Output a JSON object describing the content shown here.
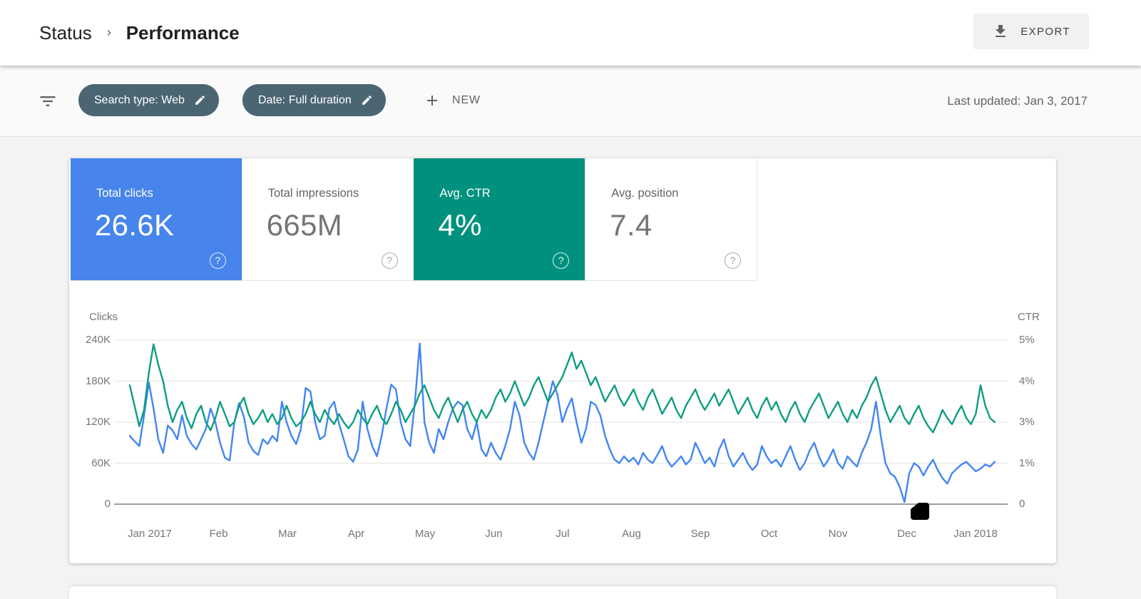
{
  "header": {
    "breadcrumb": {
      "root": "Status",
      "current": "Performance"
    },
    "export_label": "EXPORT"
  },
  "filter_bar": {
    "chips": [
      {
        "label": "Search type: Web"
      },
      {
        "label": "Date: Full duration"
      }
    ],
    "new_label": "NEW",
    "last_updated": "Last updated: Jan 3, 2017"
  },
  "metrics": [
    {
      "label": "Total clicks",
      "value": "26.6K",
      "selected": true,
      "color": "#4784ec"
    },
    {
      "label": "Total impressions",
      "value": "665M",
      "selected": false,
      "color": ""
    },
    {
      "label": "Avg. CTR",
      "value": "4%",
      "selected": true,
      "color": "#00917e"
    },
    {
      "label": "Avg. position",
      "value": "7.4",
      "selected": false,
      "color": ""
    }
  ],
  "chart_data": {
    "type": "line",
    "title": "Clicks and CTR over time, daily, Jan 2017 - Jan 2018",
    "grid": true,
    "legend_position": "none",
    "x_labels": [
      "Jan 2017",
      "Feb",
      "Mar",
      "Apr",
      "May",
      "Jun",
      "Jul",
      "Aug",
      "Sep",
      "Oct",
      "Nov",
      "Dec",
      "Jan 2018"
    ],
    "left_axis": {
      "label": "Clicks",
      "tick_labels": [
        "0",
        "60K",
        "120K",
        "180K",
        "240K"
      ],
      "tick_values": [
        0,
        60,
        120,
        180,
        240
      ],
      "unit": "thousands",
      "ylim": [
        0,
        240
      ]
    },
    "right_axis": {
      "label": "CTR",
      "tick_labels": [
        "0",
        "1%",
        "3%",
        "4%",
        "5%"
      ],
      "tick_values": [
        0,
        1,
        3,
        4,
        5
      ],
      "unit": "percent",
      "ylim": [
        0,
        5
      ]
    },
    "series": [
      {
        "name": "Clicks",
        "axis": "left",
        "color": "#4285f4",
        "unit": "K",
        "values": [
          100,
          92,
          85,
          130,
          178,
          140,
          95,
          75,
          115,
          108,
          95,
          130,
          100,
          88,
          80,
          95,
          110,
          140,
          120,
          90,
          68,
          64,
          120,
          148,
          128,
          90,
          78,
          72,
          95,
          88,
          100,
          92,
          150,
          120,
          100,
          88,
          110,
          170,
          165,
          120,
          95,
          100,
          140,
          150,
          118,
          95,
          70,
          62,
          80,
          150,
          110,
          85,
          70,
          100,
          140,
          175,
          168,
          120,
          95,
          85,
          150,
          235,
          120,
          90,
          75,
          110,
          95,
          120,
          140,
          150,
          145,
          110,
          95,
          120,
          80,
          70,
          90,
          75,
          65,
          85,
          110,
          150,
          130,
          90,
          75,
          65,
          90,
          120,
          150,
          180,
          160,
          120,
          140,
          155,
          120,
          90,
          110,
          150,
          145,
          130,
          100,
          80,
          65,
          60,
          70,
          62,
          68,
          58,
          75,
          65,
          60,
          72,
          85,
          65,
          55,
          62,
          70,
          58,
          65,
          90,
          75,
          60,
          68,
          55,
          80,
          95,
          70,
          55,
          65,
          75,
          60,
          50,
          58,
          85,
          70,
          60,
          65,
          55,
          70,
          85,
          65,
          50,
          60,
          78,
          90,
          70,
          55,
          65,
          80,
          60,
          52,
          70,
          62,
          55,
          75,
          90,
          110,
          150,
          100,
          60,
          45,
          40,
          25,
          3,
          45,
          60,
          55,
          42,
          55,
          65,
          50,
          38,
          30,
          45,
          52,
          58,
          62,
          55,
          48,
          52,
          58,
          55,
          62
        ]
      },
      {
        "name": "CTR",
        "axis": "right",
        "color": "#0d9d82",
        "unit": "%",
        "values": [
          3.9,
          3.4,
          2.8,
          3.3,
          4.2,
          4.9,
          4.4,
          4.0,
          3.4,
          3.0,
          3.3,
          3.5,
          3.1,
          2.7,
          3.2,
          3.4,
          3.0,
          2.6,
          3.1,
          3.5,
          3.2,
          2.8,
          3.0,
          3.4,
          3.6,
          3.2,
          2.9,
          3.1,
          3.3,
          3.0,
          3.2,
          2.9,
          3.1,
          3.4,
          3.1,
          2.8,
          3.0,
          3.2,
          3.5,
          3.2,
          3.0,
          3.3,
          3.1,
          2.9,
          3.2,
          3.0,
          2.7,
          3.0,
          3.3,
          3.1,
          2.9,
          3.2,
          3.4,
          3.1,
          2.9,
          3.2,
          3.5,
          3.3,
          3.0,
          3.2,
          3.4,
          3.7,
          3.9,
          3.6,
          3.3,
          3.1,
          3.4,
          3.6,
          3.3,
          3.0,
          3.3,
          3.5,
          3.2,
          3.0,
          3.3,
          3.1,
          3.3,
          3.6,
          3.8,
          3.5,
          3.7,
          4.0,
          3.7,
          3.4,
          3.6,
          3.9,
          4.1,
          3.8,
          3.5,
          3.7,
          3.9,
          4.1,
          4.4,
          4.7,
          4.3,
          4.5,
          4.2,
          3.9,
          4.1,
          3.8,
          3.5,
          3.7,
          3.9,
          3.6,
          3.4,
          3.6,
          3.8,
          3.5,
          3.3,
          3.6,
          3.8,
          3.5,
          3.2,
          3.4,
          3.6,
          3.3,
          3.1,
          3.4,
          3.6,
          3.8,
          3.5,
          3.3,
          3.5,
          3.7,
          3.4,
          3.6,
          3.8,
          3.5,
          3.2,
          3.4,
          3.6,
          3.3,
          3.1,
          3.4,
          3.6,
          3.3,
          3.5,
          3.2,
          3.0,
          3.3,
          3.5,
          3.2,
          3.0,
          3.3,
          3.5,
          3.7,
          3.4,
          3.1,
          3.3,
          3.5,
          3.2,
          3.0,
          3.3,
          3.1,
          3.4,
          3.6,
          3.9,
          4.1,
          3.7,
          3.3,
          3.0,
          3.2,
          3.4,
          3.1,
          2.9,
          3.2,
          3.4,
          3.1,
          2.8,
          2.5,
          3.0,
          3.3,
          3.1,
          2.9,
          3.2,
          3.4,
          3.1,
          2.9,
          3.2,
          3.9,
          3.4,
          3.1,
          3.0
        ]
      }
    ]
  }
}
